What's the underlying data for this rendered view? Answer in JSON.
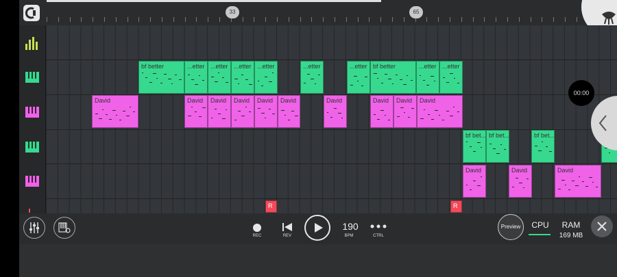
{
  "ruler": {
    "marker_a": "33",
    "marker_b": "65"
  },
  "time_badge": "00:00",
  "clips": [
    {
      "id": "g1",
      "label": "bf better",
      "color": "#37d98f"
    },
    {
      "id": "g2",
      "label": "...etter",
      "color": "#37d98f"
    },
    {
      "id": "p1",
      "label": "David",
      "color": "#f062e8"
    },
    {
      "id": "g3",
      "label": "bf bet...",
      "color": "#37d98f"
    },
    {
      "id": "r1",
      "label": "R",
      "color": "#f24a5a"
    }
  ],
  "transport": {
    "rec_label": "REC",
    "rev_label": "REV",
    "bpm_value": "190",
    "bpm_label": "BPM",
    "ctrl_label": "CTRL"
  },
  "right": {
    "preview_label": "Preview",
    "cpu_label": "CPU",
    "ram_label": "RAM",
    "ram_value": "169 MB"
  },
  "icons": [
    "menu-icon",
    "fl-logo-icon",
    "mixer-icon",
    "piano-green-icon",
    "piano-pink-icon",
    "record-icon",
    "rewind-icon",
    "play-icon",
    "more-icon",
    "sliders-icon",
    "piano-settings-icon",
    "close-icon",
    "chevron-left-icon"
  ]
}
